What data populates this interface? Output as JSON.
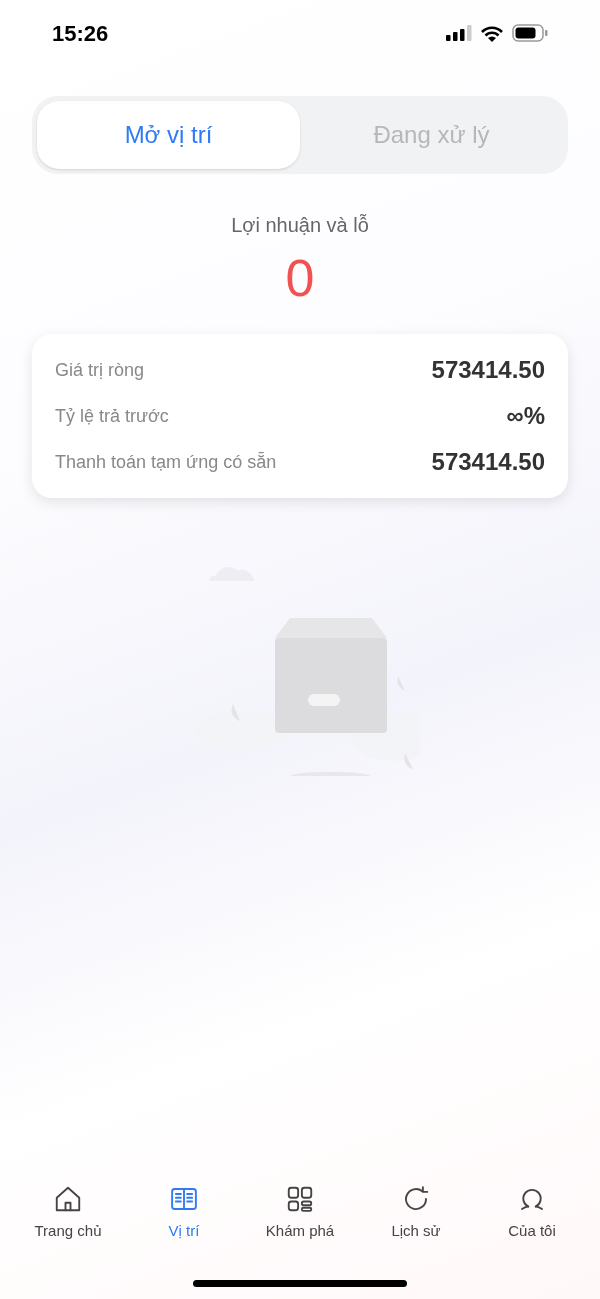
{
  "status_bar": {
    "time": "15:26"
  },
  "tabs": [
    {
      "label": "Mở vị trí",
      "selected": true
    },
    {
      "label": "Đang xử lý",
      "selected": false
    }
  ],
  "profit": {
    "label": "Lợi nhuận và lỗ",
    "value": "0"
  },
  "summary": [
    {
      "label": "Giá trị ròng",
      "value": "573414.50"
    },
    {
      "label": "Tỷ lệ trả trước",
      "value": "∞%"
    },
    {
      "label": "Thanh toán tạm ứng có sẵn",
      "value": "573414.50"
    }
  ],
  "nav": [
    {
      "kind": "home",
      "label": "Trang chủ",
      "selected": false
    },
    {
      "kind": "book",
      "label": "Vị trí",
      "selected": true
    },
    {
      "kind": "grid",
      "label": "Khám phá",
      "selected": false
    },
    {
      "kind": "refresh",
      "label": "Lịch sử",
      "selected": false
    },
    {
      "kind": "user",
      "label": "Của tôi",
      "selected": false
    }
  ]
}
